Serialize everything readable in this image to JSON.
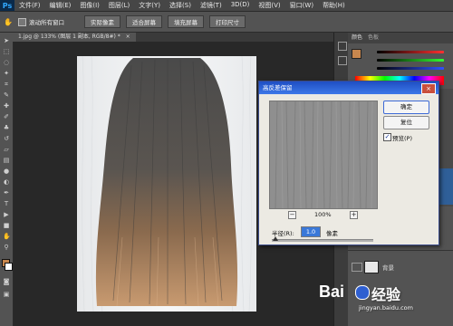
{
  "app": {
    "logo": "Ps"
  },
  "menu": [
    "文件(F)",
    "编辑(E)",
    "图像(I)",
    "图层(L)",
    "文字(Y)",
    "选择(S)",
    "滤镜(T)",
    "3D(D)",
    "视图(V)",
    "窗口(W)",
    "帮助(H)"
  ],
  "options_bar": {
    "scroll_all_label": "滚动所有窗口",
    "buttons": [
      "实际像素",
      "适合屏幕",
      "填充屏幕",
      "打印尺寸"
    ]
  },
  "document": {
    "tab_title": "1.jpg @ 133% (图层 1 副本, RGB/8#) *"
  },
  "panels": {
    "tabs": [
      "颜色",
      "色板"
    ],
    "layer_name": "背景",
    "accent_colors": {
      "foreground": "#c8874e",
      "red": "#d03030",
      "green": "#30a030",
      "blue": "#3050d0"
    }
  },
  "dialog": {
    "title": "高反差保留",
    "ok_label": "确定",
    "reset_label": "复位",
    "preview_label": "预览(P)",
    "preview_checked": true,
    "zoom_level": "100%",
    "radius_label": "半径(R):",
    "radius_value": "1.0",
    "radius_unit": "像素"
  },
  "watermark": {
    "brand": "Bai",
    "brand2": "经验",
    "url": "jingyan.baidu.com"
  }
}
